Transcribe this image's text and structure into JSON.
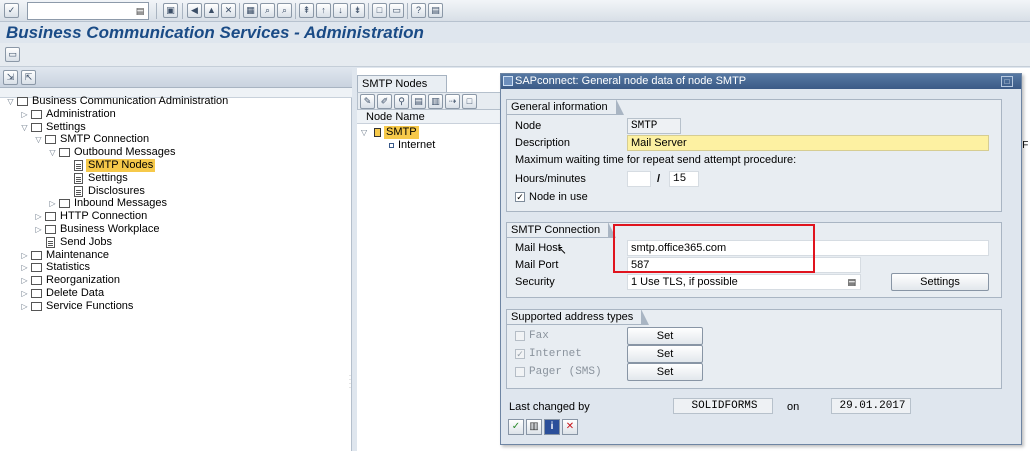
{
  "title": "Business Communication Services - Administration",
  "command_field": {
    "value": ""
  },
  "tree": {
    "items": [
      {
        "label": "Business Communication Administration",
        "level": 0,
        "expanded": true,
        "type": "folder"
      },
      {
        "label": "Administration",
        "level": 1,
        "expanded": false,
        "type": "folder"
      },
      {
        "label": "Settings",
        "level": 1,
        "expanded": true,
        "type": "folder"
      },
      {
        "label": "SMTP Connection",
        "level": 2,
        "expanded": true,
        "type": "folder"
      },
      {
        "label": "Outbound Messages",
        "level": 3,
        "expanded": true,
        "type": "folder"
      },
      {
        "label": "SMTP Nodes",
        "level": 4,
        "type": "doc",
        "selected": true
      },
      {
        "label": "Settings",
        "level": 4,
        "type": "doc"
      },
      {
        "label": "Disclosures",
        "level": 4,
        "type": "doc"
      },
      {
        "label": "Inbound Messages",
        "level": 3,
        "expanded": false,
        "type": "folder"
      },
      {
        "label": "HTTP Connection",
        "level": 2,
        "expanded": false,
        "type": "folder"
      },
      {
        "label": "Business Workplace",
        "level": 2,
        "expanded": false,
        "type": "folder"
      },
      {
        "label": "Send Jobs",
        "level": 2,
        "type": "doc"
      },
      {
        "label": "Maintenance",
        "level": 1,
        "expanded": false,
        "type": "folder"
      },
      {
        "label": "Statistics",
        "level": 1,
        "expanded": false,
        "type": "folder"
      },
      {
        "label": "Reorganization",
        "level": 1,
        "expanded": false,
        "type": "folder"
      },
      {
        "label": "Delete Data",
        "level": 1,
        "expanded": false,
        "type": "folder"
      },
      {
        "label": "Service Functions",
        "level": 1,
        "expanded": false,
        "type": "folder"
      }
    ]
  },
  "nodes_panel": {
    "tab_label": "SMTP Nodes",
    "column_header": "Node Name",
    "node_smtp": "SMTP",
    "node_internet": "Internet",
    "col_o": "o",
    "col_df": "DF"
  },
  "dialog": {
    "title": "SAPconnect: General node data of node SMTP",
    "general": {
      "group_title": "General information",
      "node_label": "Node",
      "node_value": "SMTP",
      "description_label": "Description",
      "description_value": "Mail Server",
      "wait_label": "Maximum waiting time for repeat send attempt procedure:",
      "hours_label": "Hours/minutes",
      "hours_value": "",
      "separator": "/",
      "minutes_value": "15",
      "in_use_label": "Node in use",
      "in_use_checked": "✓"
    },
    "smtp": {
      "group_title": "SMTP Connection",
      "host_label": "Mail Host",
      "host_value": "smtp.office365.com",
      "port_label": "Mail Port",
      "port_value": "587",
      "security_label": "Security",
      "security_value": "1 Use TLS, if possible",
      "settings_button": "Settings"
    },
    "address_types": {
      "group_title": "Supported address types",
      "fax_label": "Fax",
      "internet_label": "Internet",
      "internet_checked": "✓",
      "pager_label": "Pager (SMS)",
      "set_button": "Set"
    },
    "last_changed": {
      "label": "Last changed by",
      "user": "SOLIDFORMS",
      "on_label": "on",
      "date": "29.01.2017"
    }
  },
  "colors": {
    "title_blue": "#1a4b86",
    "selection_yellow": "#f6c94a",
    "highlight_red": "#e0141e",
    "dialog_title_bar": "#3b5a86"
  }
}
